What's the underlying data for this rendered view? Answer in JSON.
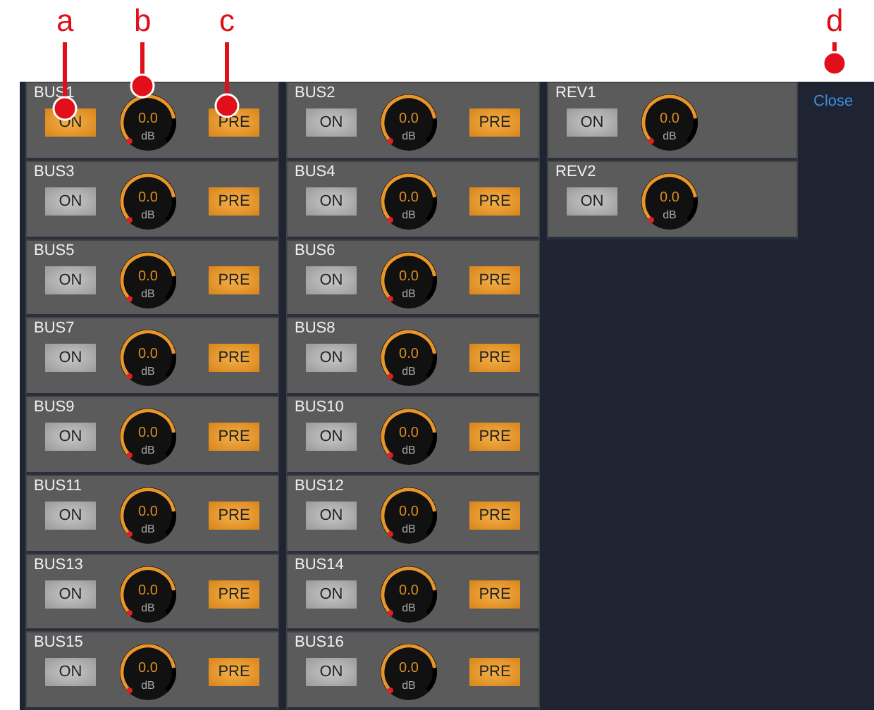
{
  "callouts": [
    {
      "label": "a"
    },
    {
      "label": "b"
    },
    {
      "label": "c"
    },
    {
      "label": "d"
    }
  ],
  "columns": [
    {
      "buses": [
        {
          "name": "BUS1",
          "on": true,
          "knob": {
            "value": "0.0",
            "unit": "dB",
            "level": 0.8
          },
          "pre": {
            "label": "PRE",
            "on": true
          },
          "on_label": "ON"
        },
        {
          "name": "BUS3",
          "on": false,
          "knob": {
            "value": "0.0",
            "unit": "dB",
            "level": 0.8
          },
          "pre": {
            "label": "PRE",
            "on": true
          },
          "on_label": "ON"
        },
        {
          "name": "BUS5",
          "on": false,
          "knob": {
            "value": "0.0",
            "unit": "dB",
            "level": 0.8
          },
          "pre": {
            "label": "PRE",
            "on": true
          },
          "on_label": "ON"
        },
        {
          "name": "BUS7",
          "on": false,
          "knob": {
            "value": "0.0",
            "unit": "dB",
            "level": 0.8
          },
          "pre": {
            "label": "PRE",
            "on": true
          },
          "on_label": "ON"
        },
        {
          "name": "BUS9",
          "on": false,
          "knob": {
            "value": "0.0",
            "unit": "dB",
            "level": 0.8
          },
          "pre": {
            "label": "PRE",
            "on": true
          },
          "on_label": "ON"
        },
        {
          "name": "BUS11",
          "on": false,
          "knob": {
            "value": "0.0",
            "unit": "dB",
            "level": 0.8
          },
          "pre": {
            "label": "PRE",
            "on": true
          },
          "on_label": "ON"
        },
        {
          "name": "BUS13",
          "on": false,
          "knob": {
            "value": "0.0",
            "unit": "dB",
            "level": 0.8
          },
          "pre": {
            "label": "PRE",
            "on": true
          },
          "on_label": "ON"
        },
        {
          "name": "BUS15",
          "on": false,
          "knob": {
            "value": "0.0",
            "unit": "dB",
            "level": 0.8
          },
          "pre": {
            "label": "PRE",
            "on": true
          },
          "on_label": "ON"
        }
      ]
    },
    {
      "buses": [
        {
          "name": "BUS2",
          "on": false,
          "knob": {
            "value": "0.0",
            "unit": "dB",
            "level": 0.8
          },
          "pre": {
            "label": "PRE",
            "on": true
          },
          "on_label": "ON"
        },
        {
          "name": "BUS4",
          "on": false,
          "knob": {
            "value": "0.0",
            "unit": "dB",
            "level": 0.8
          },
          "pre": {
            "label": "PRE",
            "on": true
          },
          "on_label": "ON"
        },
        {
          "name": "BUS6",
          "on": false,
          "knob": {
            "value": "0.0",
            "unit": "dB",
            "level": 0.8
          },
          "pre": {
            "label": "PRE",
            "on": true
          },
          "on_label": "ON"
        },
        {
          "name": "BUS8",
          "on": false,
          "knob": {
            "value": "0.0",
            "unit": "dB",
            "level": 0.8
          },
          "pre": {
            "label": "PRE",
            "on": true
          },
          "on_label": "ON"
        },
        {
          "name": "BUS10",
          "on": false,
          "knob": {
            "value": "0.0",
            "unit": "dB",
            "level": 0.8
          },
          "pre": {
            "label": "PRE",
            "on": true
          },
          "on_label": "ON"
        },
        {
          "name": "BUS12",
          "on": false,
          "knob": {
            "value": "0.0",
            "unit": "dB",
            "level": 0.8
          },
          "pre": {
            "label": "PRE",
            "on": true
          },
          "on_label": "ON"
        },
        {
          "name": "BUS14",
          "on": false,
          "knob": {
            "value": "0.0",
            "unit": "dB",
            "level": 0.8
          },
          "pre": {
            "label": "PRE",
            "on": true
          },
          "on_label": "ON"
        },
        {
          "name": "BUS16",
          "on": false,
          "knob": {
            "value": "0.0",
            "unit": "dB",
            "level": 0.8
          },
          "pre": {
            "label": "PRE",
            "on": true
          },
          "on_label": "ON"
        }
      ]
    },
    {
      "buses": [
        {
          "name": "REV1",
          "on": false,
          "knob": {
            "value": "0.0",
            "unit": "dB",
            "level": 0.8
          },
          "on_label": "ON"
        },
        {
          "name": "REV2",
          "on": false,
          "knob": {
            "value": "0.0",
            "unit": "dB",
            "level": 0.8
          },
          "on_label": "ON"
        }
      ]
    }
  ],
  "close_link": "Close"
}
